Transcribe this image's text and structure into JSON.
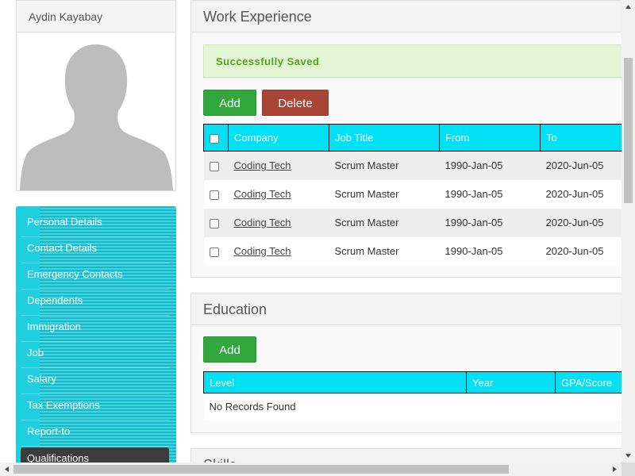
{
  "profile": {
    "name": "Aydin Kayabay"
  },
  "menu": {
    "items": [
      {
        "label": "Personal Details"
      },
      {
        "label": "Contact Details"
      },
      {
        "label": "Emergency Contacts"
      },
      {
        "label": "Dependents"
      },
      {
        "label": "Immigration"
      },
      {
        "label": "Job"
      },
      {
        "label": "Salary"
      },
      {
        "label": "Tax Exemptions"
      },
      {
        "label": "Report-to"
      },
      {
        "label": "Qualifications"
      }
    ],
    "active": "Qualifications"
  },
  "work_experience": {
    "title": "Work Experience",
    "alert": "Successfully Saved",
    "add_label": "Add",
    "delete_label": "Delete",
    "columns": [
      "Company",
      "Job Title",
      "From",
      "To"
    ],
    "rows": [
      {
        "company": "Coding Tech",
        "job_title": "Scrum Master",
        "from": "1990-Jan-05",
        "to": "2020-Jun-05"
      },
      {
        "company": "Coding Tech",
        "job_title": "Scrum Master",
        "from": "1990-Jan-05",
        "to": "2020-Jun-05"
      },
      {
        "company": "Coding Tech",
        "job_title": "Scrum Master",
        "from": "1990-Jan-05",
        "to": "2020-Jun-05"
      },
      {
        "company": "Coding Tech",
        "job_title": "Scrum Master",
        "from": "1990-Jan-05",
        "to": "2020-Jun-05"
      }
    ]
  },
  "education": {
    "title": "Education",
    "add_label": "Add",
    "columns": [
      "Level",
      "Year",
      "GPA/Score"
    ],
    "empty_message": "No Records Found"
  },
  "skills": {
    "title": "Skills"
  },
  "colors": {
    "table_header": "#00e1f5",
    "add_button": "#32a83c",
    "delete_button": "#a84537",
    "menu_active": "#3c3c3c",
    "success_text": "#5aa114"
  }
}
